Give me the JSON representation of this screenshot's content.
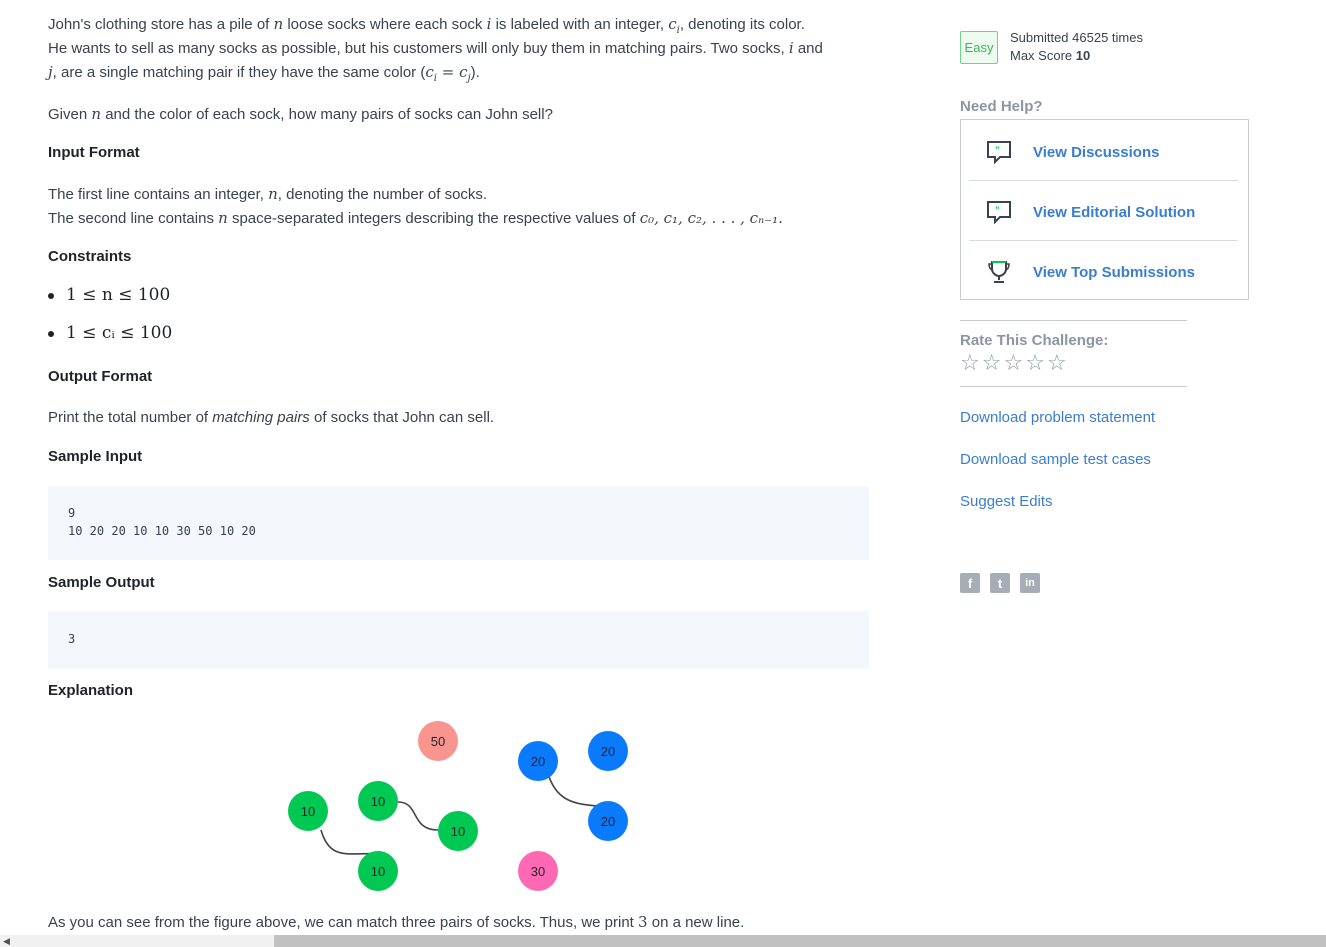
{
  "statement": {
    "intro_1a": "John's clothing store has a pile of ",
    "var_n": "n",
    "intro_1b": " loose socks where each sock ",
    "var_i": "i",
    "intro_1c": " is labeled with an integer, ",
    "var_ci": "c",
    "sub_i": "i",
    "intro_1d": ", denoting its color.",
    "intro_2": "He wants to sell as many socks as possible, but his customers will only buy them in matching pairs. Two socks, ",
    "intro_2b": " and",
    "var_j": "j",
    "intro_3a": ", are a single matching pair if they have the same color (",
    "cond": "c",
    "eq": " = ",
    "sub_j": "j",
    "intro_3b": ").",
    "given_a": "Given ",
    "given_b": " and the color of each sock, how many pairs of socks can John sell?"
  },
  "input_format": {
    "heading": "Input Format",
    "line1a": "The first line contains an integer, ",
    "line1b": ", denoting the number of socks.",
    "line2a": "The second line contains ",
    "line2b": " space-separated integers describing the respective values of ",
    "seq": "c₀, c₁, c₂, . . . , cₙ₋₁."
  },
  "constraints": {
    "heading": "Constraints",
    "items": [
      "1 ≤ n ≤ 100",
      "1 ≤ cᵢ ≤ 100"
    ]
  },
  "output_format": {
    "heading": "Output Format",
    "text_a": "Print the total number of ",
    "text_em": "matching pairs",
    "text_b": " of socks that John can sell."
  },
  "sample_input": {
    "heading": "Sample Input",
    "lines": [
      "9",
      "10 20 20 10 10 30 50 10 20"
    ]
  },
  "sample_output": {
    "heading": "Sample Output",
    "lines": [
      "3"
    ]
  },
  "explanation": {
    "heading": "Explanation",
    "nodes": [
      "50",
      "20",
      "20",
      "10",
      "10",
      "10",
      "20",
      "10",
      "30"
    ],
    "text_a": "As you can see from the figure above, we can match three pairs of socks. Thus, we print ",
    "value": "3",
    "text_b": " on a new line."
  },
  "colors": {
    "green": "#00c853",
    "blue": "#0a7bff",
    "salmon": "#f7958e",
    "pink": "#ff69b4",
    "link": "#3a7dd0"
  },
  "sidebar": {
    "difficulty": "Easy",
    "submitted": "Submitted 46525 times",
    "max_score_label": "Max Score ",
    "max_score": "10",
    "need_help": "Need Help?",
    "help_items": [
      {
        "label": "View Discussions",
        "icon": "speech-bubble-icon"
      },
      {
        "label": "View Editorial Solution",
        "icon": "speech-bubble-icon"
      },
      {
        "label": "View Top Submissions",
        "icon": "trophy-icon"
      }
    ],
    "rate_label": "Rate This Challenge:",
    "stars": [
      "☆",
      "☆",
      "☆",
      "☆",
      "☆"
    ],
    "links": [
      "Download problem statement",
      "Download sample test cases",
      "Suggest Edits"
    ],
    "social": [
      "f",
      "t",
      "in"
    ]
  }
}
